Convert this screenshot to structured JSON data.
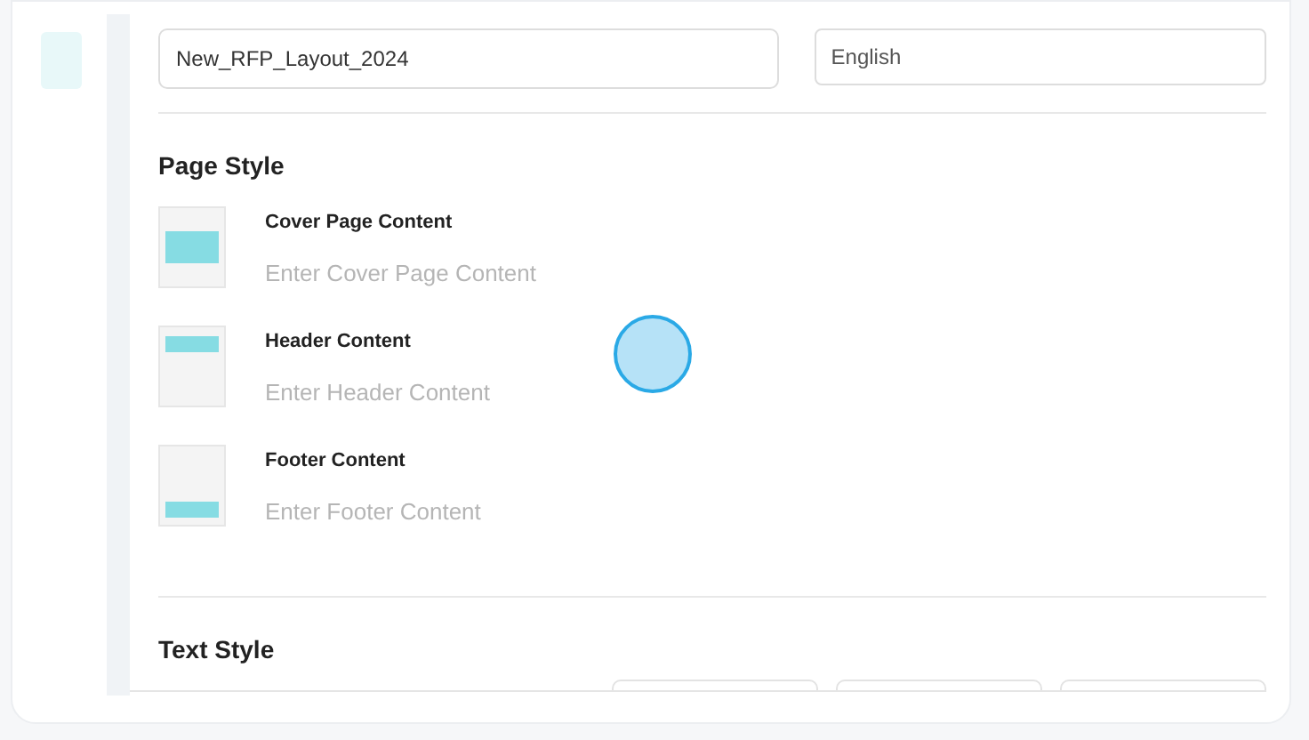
{
  "layout_name": {
    "value": "New_RFP_Layout_2024"
  },
  "language": {
    "value": "English"
  },
  "page_style": {
    "title": "Page Style",
    "items": [
      {
        "kind": "cover",
        "label": "Cover Page Content",
        "placeholder": "Enter Cover Page Content"
      },
      {
        "kind": "header",
        "label": "Header Content",
        "placeholder": "Enter Header Content"
      },
      {
        "kind": "footer",
        "label": "Footer Content",
        "placeholder": "Enter Footer Content"
      }
    ]
  },
  "text_style": {
    "title": "Text Style"
  }
}
